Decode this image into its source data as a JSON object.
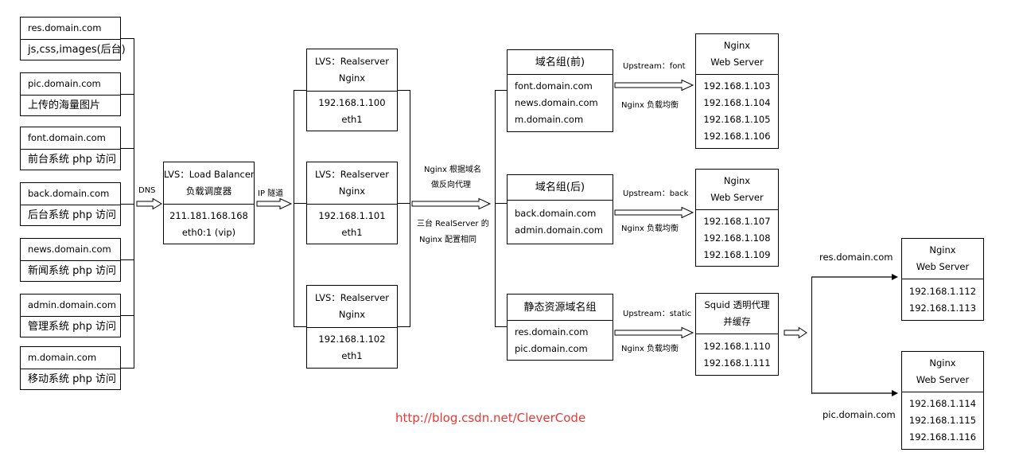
{
  "domains": [
    {
      "name": "res.domain.com",
      "desc": "js,css,images(后台)"
    },
    {
      "name": "pic.domain.com",
      "desc": "上传的海量图片"
    },
    {
      "name": "font.domain.com",
      "desc": "前台系统 php 访问"
    },
    {
      "name": "back.domain.com",
      "desc": "后台系统 php 访问"
    },
    {
      "name": "news.domain.com",
      "desc": "新闻系统 php 访问"
    },
    {
      "name": "admin.domain.com",
      "desc": "管理系统 php 访问"
    },
    {
      "name": "m.domain.com",
      "desc": "移动系统 php 访问"
    }
  ],
  "dns_label": "DNS",
  "lvs": {
    "title": [
      "LVS：Load Balancer",
      "负载调度器"
    ],
    "body": [
      "211.181.168.168",
      "eth0:1 (vip)"
    ]
  },
  "ip_tunnel_label": "IP 隧道",
  "realservers": [
    {
      "title": [
        "LVS：Realserver",
        "Nginx"
      ],
      "body": [
        "192.168.1.100",
        "eth1"
      ]
    },
    {
      "title": [
        "LVS：Realserver",
        "Nginx"
      ],
      "body": [
        "192.168.1.101",
        "eth1"
      ]
    },
    {
      "title": [
        "LVS：Realserver",
        "Nginx"
      ],
      "body": [
        "192.168.1.102",
        "eth1"
      ]
    }
  ],
  "proxy_note": {
    "above": [
      "Nginx 根据域名",
      "做反向代理"
    ],
    "below": [
      "三台 RealServer 的",
      "Nginx 配置相同"
    ]
  },
  "groups": [
    {
      "title": [
        "域名组(前)"
      ],
      "body": [
        "font.domain.com",
        "news.domain.com",
        "m.domain.com"
      ],
      "upstream": "Upstream：font",
      "lb": "Nginx 负载均衡"
    },
    {
      "title": [
        "域名组(后)"
      ],
      "body": [
        "back.domain.com",
        "admin.domain.com"
      ],
      "upstream": "Upstream：back",
      "lb": "Nginx 负载均衡"
    },
    {
      "title": [
        "静态资源域名组"
      ],
      "body": [
        "res.domain.com",
        "pic.domain.com"
      ],
      "upstream": "Upstream：static",
      "lb": "Nginx 负载均衡"
    }
  ],
  "servers": [
    {
      "title": [
        "Nginx",
        "Web Server"
      ],
      "body": [
        "192.168.1.103",
        "192.168.1.104",
        "192.168.1.105",
        "192.168.1.106"
      ]
    },
    {
      "title": [
        "Nginx",
        "Web Server"
      ],
      "body": [
        "192.168.1.107",
        "192.168.1.108",
        "192.168.1.109"
      ]
    },
    {
      "title": [
        "Squid 透明代理",
        "并缓存"
      ],
      "body": [
        "192.168.1.110",
        "192.168.1.111"
      ]
    }
  ],
  "static_servers": [
    {
      "route": "res.domain.com",
      "title": [
        "Nginx",
        "Web Server"
      ],
      "body": [
        "192.168.1.112",
        "192.168.1.113"
      ]
    },
    {
      "route": "pic.domain.com",
      "title": [
        "Nginx",
        "Web Server"
      ],
      "body": [
        "192.168.1.114",
        "192.168.1.115",
        "192.168.1.116"
      ]
    }
  ],
  "watermark": "http://blog.csdn.net/CleverCode"
}
